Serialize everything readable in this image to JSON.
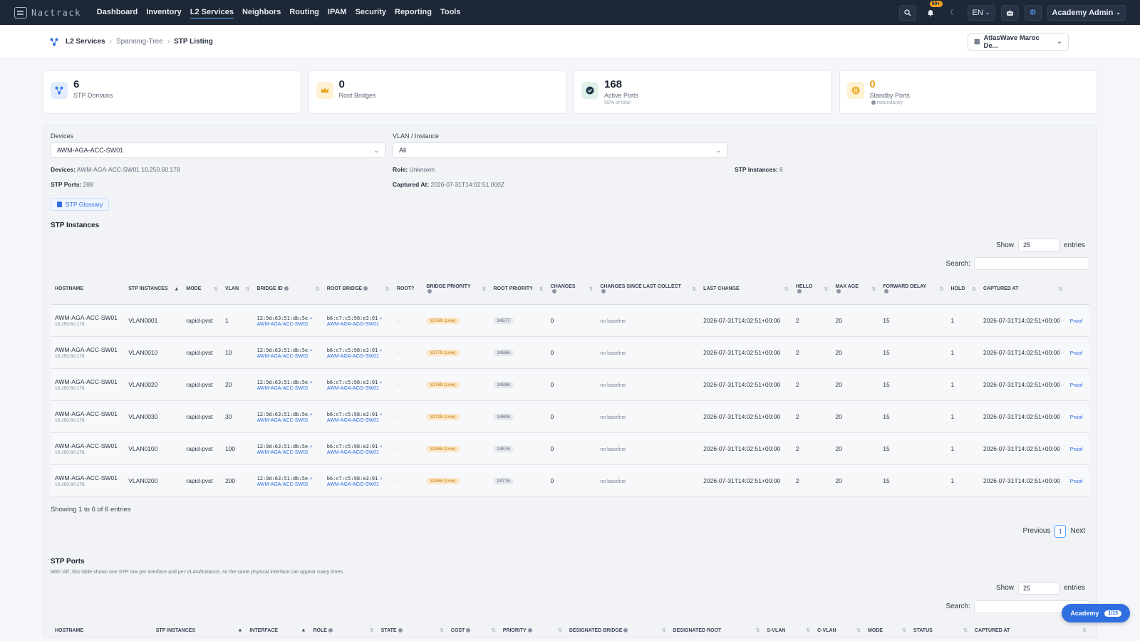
{
  "nav": {
    "brand": "Nactrack",
    "links": [
      "Dashboard",
      "Inventory",
      "L2 Services",
      "Neighbors",
      "Routing",
      "IPAM",
      "Security",
      "Reporting",
      "Tools"
    ],
    "active_index": 2,
    "bell_badge": "99+",
    "language": "EN",
    "user": "Academy Admin"
  },
  "breadcrumb": {
    "items": [
      "L2 Services",
      "Spanning-Tree",
      "STP Listing"
    ],
    "tenant": "AtlasWave Maroc De..."
  },
  "stats": [
    {
      "value": "6",
      "label": "STP Domains",
      "sub": "",
      "icon": "network-icon",
      "color": "#3b7be6",
      "bg": "#e3eefc"
    },
    {
      "value": "0",
      "label": "Root Bridges",
      "sub": "",
      "icon": "crown-icon",
      "color": "#e8a21b",
      "bg": "#fff1d4"
    },
    {
      "value": "168",
      "label": "Active Ports",
      "sub": "58% of total",
      "icon": "check-icon",
      "color": "#1f7a5a",
      "bg": "#dff3ea"
    },
    {
      "value": "0",
      "label": "Standby Ports",
      "sub": "redundancy",
      "icon": "pause-icon",
      "color": "#e8a21b",
      "bg": "#fff1d4"
    }
  ],
  "filters": {
    "devices_label": "Devices",
    "devices_value": "AWM-AGA-ACC-SW01",
    "vlan_label": "VLAN / Instance",
    "vlan_value": "All"
  },
  "meta": {
    "devices_key": "Devices:",
    "devices_val": "AWM-AGA-ACC-SW01 10.250.60.178",
    "role_key": "Role:",
    "role_val": "Unknown",
    "instances_key": "STP Instances:",
    "instances_val": "6",
    "ports_key": "STP Ports:",
    "ports_val": "288",
    "captured_key": "Captured At:",
    "captured_val": "2026-07-31T14:02:51.000Z"
  },
  "glossary_label": "STP Glossary",
  "instances": {
    "title": "STP Instances",
    "show_label": "Show",
    "show_value": "25",
    "entries_label": "entries",
    "search_label": "Search:",
    "headers": [
      "HOSTNAME",
      "STP INSTANCES",
      "MODE",
      "VLAN",
      "BRIDGE ID",
      "ROOT BRIDGE",
      "ROOT?",
      "BRIDGE PRIORITY",
      "ROOT PRIORITY",
      "CHANGES",
      "CHANGES SINCE LAST COLLECT",
      "LAST CHANGE",
      "HELLO",
      "MAX AGE",
      "FORWARD DELAY",
      "HOLD",
      "CAPTURED AT",
      ""
    ],
    "rows": [
      {
        "host": "AWM-AGA-ACC-SW01",
        "ip": "10.250.60.178",
        "instance": "VLAN0001",
        "mode": "rapid-pvst",
        "vlan": "1",
        "bridge_id": "12:9d:63:51:db:5e",
        "bridge_host": "AWM-AGA-ACC-SW01",
        "root_bridge": "b6:c7:c5:98:e3:91",
        "root_host": "AWM-AGA-AGG-SW01",
        "is_root": "-",
        "bridge_priority": "32769 (Low)",
        "root_priority": "24577",
        "changes": "0",
        "since": "no baseline",
        "last_change": "2026-07-31T14:02:51+00:00",
        "hello": "2",
        "max_age": "20",
        "fwd": "15",
        "hold": "1",
        "captured": "2026-07-31T14:02:51+00:00",
        "action": "Proof"
      },
      {
        "host": "AWM-AGA-ACC-SW01",
        "ip": "10.250.60.178",
        "instance": "VLAN0010",
        "mode": "rapid-pvst",
        "vlan": "10",
        "bridge_id": "12:9d:63:51:db:5e",
        "bridge_host": "AWM-AGA-ACC-SW01",
        "root_bridge": "b6:c7:c5:98:e3:91",
        "root_host": "AWM-AGA-AGG-SW01",
        "is_root": "-",
        "bridge_priority": "32778 (Low)",
        "root_priority": "24586",
        "changes": "0",
        "since": "no baseline",
        "last_change": "2026-07-31T14:02:51+00:00",
        "hello": "2",
        "max_age": "20",
        "fwd": "15",
        "hold": "1",
        "captured": "2026-07-31T14:02:51+00:00",
        "action": "Proof"
      },
      {
        "host": "AWM-AGA-ACC-SW01",
        "ip": "10.250.60.178",
        "instance": "VLAN0020",
        "mode": "rapid-pvst",
        "vlan": "20",
        "bridge_id": "12:9d:63:51:db:5e",
        "bridge_host": "AWM-AGA-ACC-SW01",
        "root_bridge": "b6:c7:c5:98:e3:91",
        "root_host": "AWM-AGA-AGG-SW01",
        "is_root": "-",
        "bridge_priority": "32788 (Low)",
        "root_priority": "24596",
        "changes": "0",
        "since": "no baseline",
        "last_change": "2026-07-31T14:02:51+00:00",
        "hello": "2",
        "max_age": "20",
        "fwd": "15",
        "hold": "1",
        "captured": "2026-07-31T14:02:51+00:00",
        "action": "Proof"
      },
      {
        "host": "AWM-AGA-ACC-SW01",
        "ip": "10.250.60.178",
        "instance": "VLAN0030",
        "mode": "rapid-pvst",
        "vlan": "30",
        "bridge_id": "12:9d:63:51:db:5e",
        "bridge_host": "AWM-AGA-ACC-SW01",
        "root_bridge": "b6:c7:c5:98:e3:91",
        "root_host": "AWM-AGA-AGG-SW01",
        "is_root": "-",
        "bridge_priority": "32798 (Low)",
        "root_priority": "24606",
        "changes": "0",
        "since": "no baseline",
        "last_change": "2026-07-31T14:02:51+00:00",
        "hello": "2",
        "max_age": "20",
        "fwd": "15",
        "hold": "1",
        "captured": "2026-07-31T14:02:51+00:00",
        "action": "Proof"
      },
      {
        "host": "AWM-AGA-ACC-SW01",
        "ip": "10.250.60.178",
        "instance": "VLAN0100",
        "mode": "rapid-pvst",
        "vlan": "100",
        "bridge_id": "12:9d:63:51:db:5e",
        "bridge_host": "AWM-AGA-ACC-SW01",
        "root_bridge": "b6:c7:c5:98:e3:91",
        "root_host": "AWM-AGA-AGG-SW01",
        "is_root": "-",
        "bridge_priority": "32868 (Low)",
        "root_priority": "24676",
        "changes": "0",
        "since": "no baseline",
        "last_change": "2026-07-31T14:02:51+00:00",
        "hello": "2",
        "max_age": "20",
        "fwd": "15",
        "hold": "1",
        "captured": "2026-07-31T14:02:51+00:00",
        "action": "Proof"
      },
      {
        "host": "AWM-AGA-ACC-SW01",
        "ip": "10.250.60.178",
        "instance": "VLAN0200",
        "mode": "rapid-pvst",
        "vlan": "200",
        "bridge_id": "12:9d:63:51:db:5e",
        "bridge_host": "AWM-AGA-ACC-SW01",
        "root_bridge": "b6:c7:c5:98:e3:91",
        "root_host": "AWM-AGA-AGG-SW01",
        "is_root": "-",
        "bridge_priority": "32968 (Low)",
        "root_priority": "24776",
        "changes": "0",
        "since": "no baseline",
        "last_change": "2026-07-31T14:02:51+00:00",
        "hello": "2",
        "max_age": "20",
        "fwd": "15",
        "hold": "1",
        "captured": "2026-07-31T14:02:51+00:00",
        "action": "Proof"
      }
    ],
    "showing": "Showing 1 to 6 of 6 entries",
    "prev": "Previous",
    "page": "1",
    "next": "Next"
  },
  "ports": {
    "title": "STP Ports",
    "note": "With 'All', this table shows one STP row per interface and per VLAN/instance, so the same physical interface can appear many times.",
    "show_label": "Show",
    "show_value": "25",
    "entries_label": "entries",
    "search_label": "Search:",
    "headers": [
      "HOSTNAME",
      "STP INSTANCES",
      "INTERFACE",
      "ROLE",
      "STATE",
      "COST",
      "PRIORITY",
      "DESIGNATED BRIDGE",
      "DESIGNATED ROOT",
      "S-VLAN",
      "C-VLAN",
      "MODE",
      "STATUS",
      "CAPTURED AT"
    ]
  },
  "academy": {
    "label": "Academy",
    "count": "1/15"
  }
}
